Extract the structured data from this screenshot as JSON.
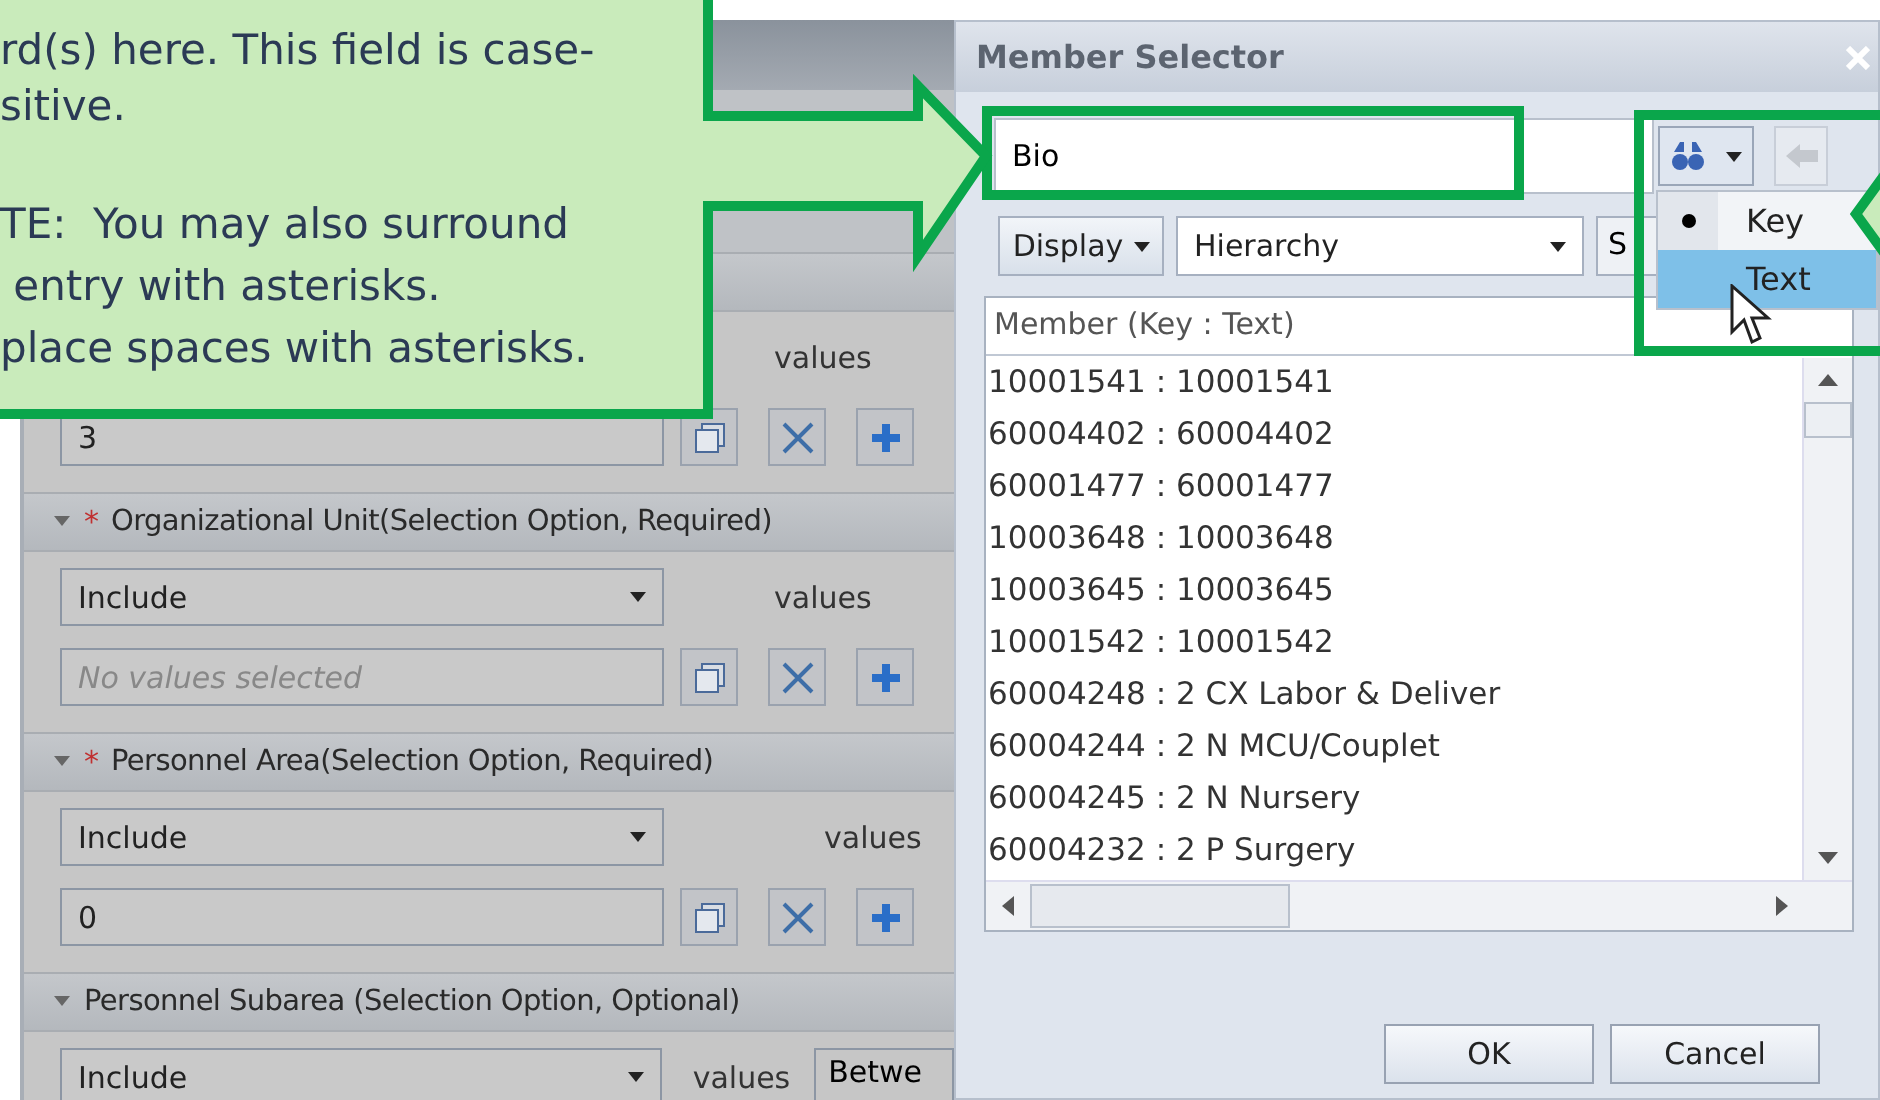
{
  "callout": {
    "paragraphs": [
      [
        "rd(s) here. This field is case-",
        "sitive."
      ],
      [
        "TE:  You may also surround",
        " entry with asterisks.",
        "place spaces with asterisks."
      ]
    ]
  },
  "filter_panel": {
    "top_section": {
      "values_label": "values",
      "value": "3"
    },
    "sections": [
      {
        "title": "Organizational Unit(Selection Option, Required)",
        "required_mark": "*",
        "expanded": true,
        "operator": "Include",
        "values_label": "values",
        "placeholder": "No values selected"
      },
      {
        "title": "Personnel Area(Selection Option, Required)",
        "required_mark": "*",
        "expanded": true,
        "operator": "Include",
        "values_label": "values",
        "value": "0"
      },
      {
        "title": "Personnel Subarea (Selection Option, Optional)",
        "expanded": true,
        "operator": "Include",
        "values_label": "values",
        "range": "Betwe"
      }
    ]
  },
  "dialog": {
    "title": "Member Selector",
    "search": {
      "value": "Bio"
    },
    "search_menu": [
      {
        "label": "Key",
        "selected": true,
        "hovered": false
      },
      {
        "label": "Text",
        "selected": false,
        "hovered": true
      }
    ],
    "display_button": "Display",
    "hierarchy": "Hierarchy",
    "partial_button": "S",
    "list": {
      "header": "Member (Key : Text)",
      "rows": [
        "10001541 : 10001541",
        "60004402 : 60004402",
        "60001477 : 60001477",
        "10003648 : 10003648",
        "10003645 : 10003645",
        "10001542 : 10001542",
        "60004248 : 2 CX Labor & Deliver",
        "60004244 : 2 N MCU/Couplet",
        "60004245 : 2 N Nursery",
        "60004232 : 2 P Surgery"
      ]
    },
    "buttons": [
      "OK",
      "Cancel"
    ]
  }
}
